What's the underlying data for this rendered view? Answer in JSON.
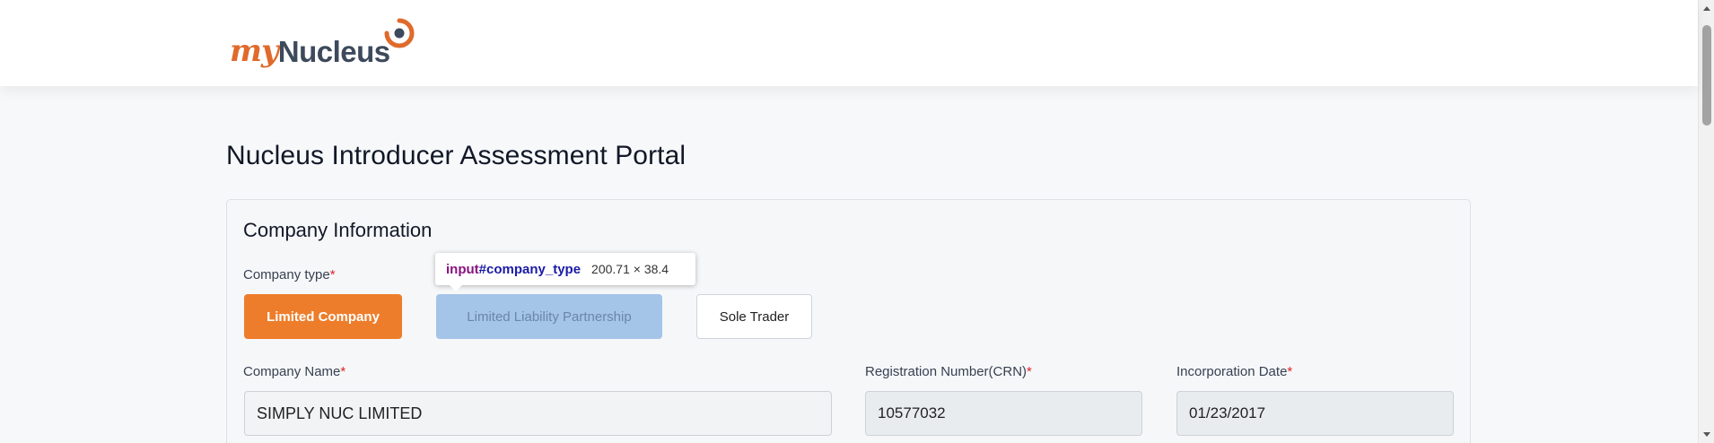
{
  "brand": {
    "logo_my": "my",
    "logo_nucleus": "Nucleus",
    "primary_color": "#ee7d2b",
    "text_color": "#3d4a5c"
  },
  "page": {
    "title": "Nucleus Introducer Assessment Portal"
  },
  "company_info": {
    "section_title": "Company Information",
    "company_type": {
      "label": "Company type",
      "required": "*",
      "options": [
        "Limited Company",
        "Limited Liability Partnership",
        "Sole Trader"
      ],
      "selected": "Limited Company"
    },
    "company_name": {
      "label": "Company Name",
      "required": "*",
      "value": "SIMPLY NUC LIMITED"
    },
    "registration_number": {
      "label": "Registration Number(CRN)",
      "required": "*",
      "value": "10577032"
    },
    "incorporation_date": {
      "label": "Incorporation Date",
      "required": "*",
      "value": "01/23/2017"
    }
  },
  "devtools_tooltip": {
    "tag": "input",
    "id": "#company_type",
    "dimensions": "200.71 × 38.4"
  }
}
